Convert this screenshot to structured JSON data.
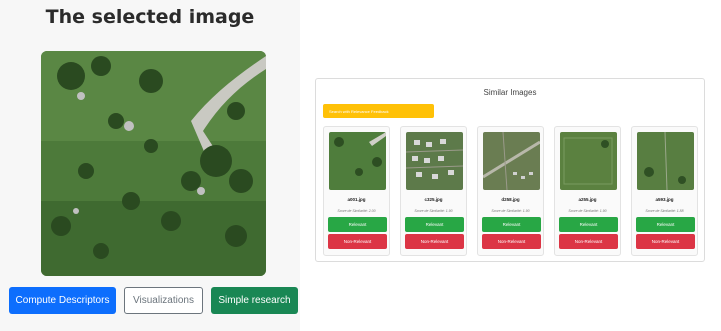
{
  "selected": {
    "title": "The selected image"
  },
  "actions": {
    "compute_label": "Compute Descriptors",
    "visualize_label": "Visualizations",
    "simple_label": "Simple research"
  },
  "results": {
    "title": "Similar Images",
    "feedback_label": "Search with Relevance Feedback",
    "items": [
      {
        "name": "a001.jpg",
        "score": "Score de Similarité: 2.00",
        "relevant": "Relevant",
        "non_relevant": "Non-Relevant"
      },
      {
        "name": "c325.jpg",
        "score": "Score de Similarité: 1.90",
        "relevant": "Relevant",
        "non_relevant": "Non-Relevant"
      },
      {
        "name": "d258.jpg",
        "score": "Score de Similarité: 1.90",
        "relevant": "Relevant",
        "non_relevant": "Non-Relevant"
      },
      {
        "name": "a255.jpg",
        "score": "Score de Similarité: 1.90",
        "relevant": "Relevant",
        "non_relevant": "Non-Relevant"
      },
      {
        "name": "a593.jpg",
        "score": "Score de Similarité: 1.88",
        "relevant": "Relevant",
        "non_relevant": "Non-Relevant"
      }
    ]
  },
  "colors": {
    "primary": "#0d6efd",
    "secondary": "#6c757d",
    "success": "#198754",
    "relevant": "#28a745",
    "non_relevant": "#dc3545",
    "warning": "#ffc107"
  }
}
